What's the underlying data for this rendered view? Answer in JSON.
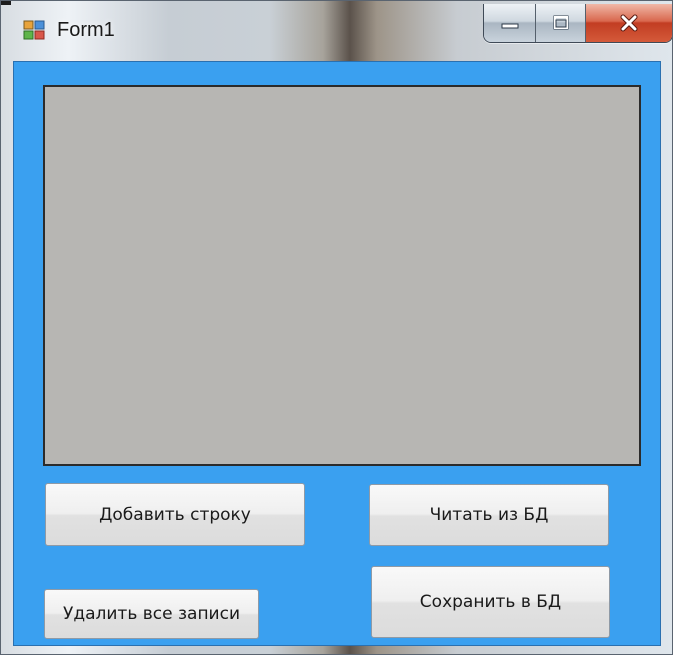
{
  "window": {
    "title": "Form1",
    "accent_color": "#3aa0f0",
    "icons": {
      "app": "form-app-icon",
      "minimize": "minimize-icon",
      "maximize": "maximize-icon",
      "close": "close-icon"
    }
  },
  "buttons": {
    "add_row": "Добавить строку",
    "read_db": "Читать из БД",
    "delete_all": "Удалить все записи",
    "save_db": "Сохранить в БД"
  }
}
